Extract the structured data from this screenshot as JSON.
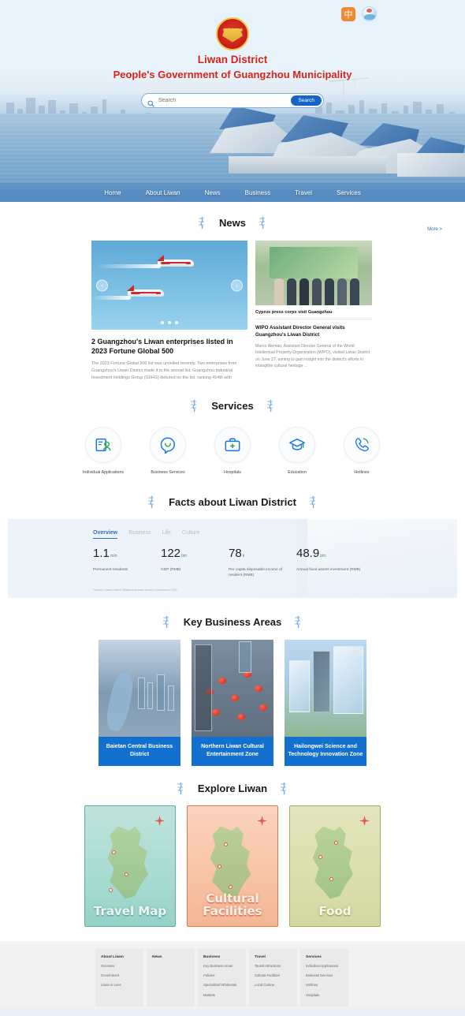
{
  "header": {
    "lang_button": "中",
    "lang_icon": "globe-icon",
    "emblem_icon": "national-emblem-icon",
    "title": "Liwan District",
    "subtitle": "People's Government of Guangzhou Municipality",
    "search": {
      "placeholder": "Search",
      "value": "",
      "button_label": "Search",
      "icon": "search-icon"
    },
    "nav": [
      {
        "label": "Home"
      },
      {
        "label": "About Liwan"
      },
      {
        "label": "News"
      },
      {
        "label": "Business"
      },
      {
        "label": "Travel"
      },
      {
        "label": "Services"
      }
    ]
  },
  "news": {
    "section_title": "News",
    "more_label": "More >",
    "carousel": {
      "prev_icon": "chevron-left-icon",
      "next_icon": "chevron-right-icon",
      "slide_count": 3,
      "active_slide": 1
    },
    "featured": {
      "headline": "2 Guangzhou's Liwan enterprises listed in 2023 Fortune Global 500",
      "body": "The 2023 Fortune Global 500 list was unveiled recently. Two enterprises from Guangzhou's Liwan District made it to the annual list. Guangzhou Industrial Investment Holdings Group (GIIHG) debuted on the list, ranking 414th with"
    },
    "side": {
      "caption": "Cyprus press corps visit Guangzhou",
      "title": "WIPO Assistant Director General visits Guangzhou's Liwan District",
      "body": "Marco Aleman, Assistant Director General of the World Intellectual Property Organization (WIPO), visited Liwan District on June 27, aiming to gain insight into the district's efforts in intangible cultural heritage ..."
    }
  },
  "services": {
    "section_title": "Services",
    "items": [
      {
        "label": "Individual Applications",
        "icon": "individual-application-icon"
      },
      {
        "label": "Business Services",
        "icon": "business-services-icon"
      },
      {
        "label": "Hospitals",
        "icon": "medical-kit-icon"
      },
      {
        "label": "Education",
        "icon": "graduation-cap-icon"
      },
      {
        "label": "Hotlines",
        "icon": "phone-icon"
      }
    ]
  },
  "facts": {
    "section_title": "Facts about Liwan District",
    "tabs": [
      {
        "label": "Overview",
        "active": true
      },
      {
        "label": "Business",
        "active": false
      },
      {
        "label": "Life",
        "active": false
      },
      {
        "label": "Culture",
        "active": false
      }
    ],
    "stats": [
      {
        "value": "1.1",
        "unit": "mln",
        "label": "Permanent residents"
      },
      {
        "value": "122",
        "unit": "bln",
        "label": "GDP (RMB)"
      },
      {
        "value": "78",
        "unit": "k",
        "label": "Per capita disposable income of resident (RMB)"
      },
      {
        "value": "48.9",
        "unit": "bln",
        "label": "Annual fixed assets investment (RMB)"
      }
    ],
    "source": "*Source: Liwan District Statistics Bureau Survey conducted in 2022"
  },
  "business_areas": {
    "section_title": "Key Business Areas",
    "cards": [
      {
        "label": "Baietan Central Business District"
      },
      {
        "label": "Northern Liwan Cultural Entertainment Zone"
      },
      {
        "label": "Hailongwei Science and Technology Innovation Zone"
      }
    ]
  },
  "explore": {
    "section_title": "Explore Liwan",
    "cards": [
      {
        "label": "Travel Map"
      },
      {
        "label": "Cultural Facilities"
      },
      {
        "label": "Food"
      }
    ]
  },
  "footer": {
    "columns": [
      {
        "title": "About Liwan",
        "links": [
          "Overview",
          "Government",
          "Liwan in Lens"
        ]
      },
      {
        "title": "News",
        "links": []
      },
      {
        "title": "Business",
        "links": [
          "Key Business Areas",
          "Policies",
          "Specialized Wholesale",
          "Markets"
        ]
      },
      {
        "title": "Travel",
        "links": [
          "Tourist Attractions",
          "Cultural Facilities",
          "Local Cuisine"
        ]
      },
      {
        "title": "Services",
        "links": [
          "Individual Applications",
          "Business Services",
          "Hotlines",
          "Hospitals"
        ]
      }
    ]
  },
  "colors": {
    "accent_blue": "#1470cf",
    "brand_red": "#d5231b",
    "lang_orange": "#f08a31",
    "stat_green": "#3aa35a"
  }
}
